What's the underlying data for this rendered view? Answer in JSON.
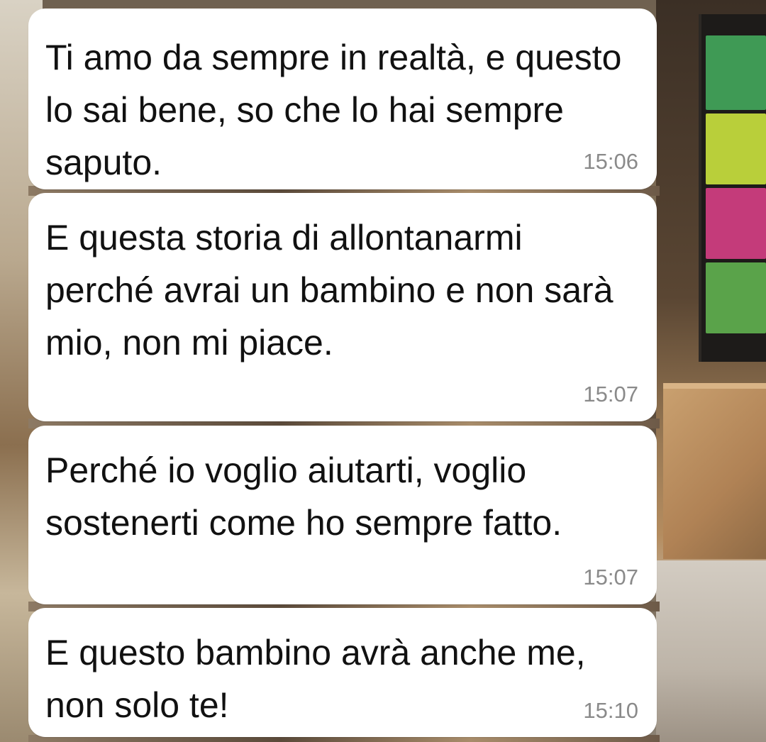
{
  "conversation": {
    "messages": [
      {
        "text": "Ti amo da sempre in realtà, e questo lo sai bene, so che lo hai sempre saputo.",
        "time": "15:06"
      },
      {
        "text": "E questa storia di allontanarmi perché avrai un bambino e non sarà mio, non mi piace.",
        "time": "15:07"
      },
      {
        "text": "Perché io voglio aiutarti, voglio sostenerti come ho sempre fatto.",
        "time": "15:07"
      },
      {
        "text": "E questo bambino avrà anche me, non solo te!",
        "time": "15:10"
      }
    ]
  },
  "colors": {
    "bubble_background": "#ffffff",
    "message_text": "#111111",
    "timestamp_text": "#8a8a8a"
  }
}
